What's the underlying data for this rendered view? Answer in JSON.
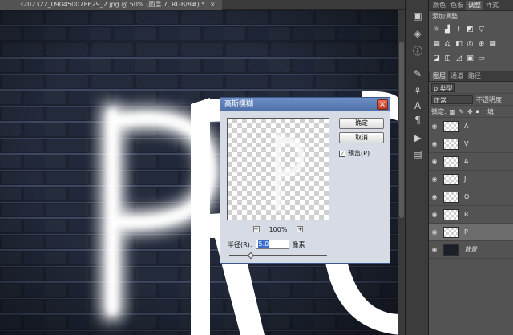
{
  "document": {
    "tab_title": "3202322_090450078629_2.jpg @ 50% (图层 7, RGB/8#) *",
    "close_glyph": "×",
    "canvas_text": "PRO"
  },
  "right_panel": {
    "top_tabs": [
      "颜色",
      "色板",
      "调整",
      "样式"
    ],
    "active_top_tab": "调整",
    "adjustments_title": "添加调整",
    "adjustment_icons": [
      [
        "brightness-icon",
        "levels-icon",
        "curves-icon",
        "exposure-icon"
      ],
      [
        "vibrance-icon",
        "hue-saturation-icon",
        "color-balance-icon",
        "black-white-icon",
        "photo-filter-icon",
        "channel-mixer-icon"
      ],
      [
        "invert-icon",
        "posterize-icon",
        "threshold-icon",
        "selective-color-icon",
        "gradient-map-icon"
      ]
    ],
    "layer_tabs": [
      "图层",
      "通道",
      "路径"
    ],
    "active_layer_tab": "图层",
    "filter_kind": "ρ 类型",
    "blend_mode": "正常",
    "opacity_label": "不透明度",
    "lock_label": "锁定:",
    "fill_label": "填"
  },
  "layers": [
    {
      "name": "A",
      "selected": false,
      "background": false
    },
    {
      "name": "V",
      "selected": false,
      "background": false
    },
    {
      "name": "A",
      "selected": false,
      "background": false
    },
    {
      "name": "J",
      "selected": false,
      "background": false
    },
    {
      "name": "O",
      "selected": false,
      "background": false
    },
    {
      "name": "R",
      "selected": false,
      "background": false
    },
    {
      "name": "P",
      "selected": true,
      "background": false
    },
    {
      "name": "背景",
      "selected": false,
      "background": true
    }
  ],
  "dialog": {
    "title": "高斯模糊",
    "close_glyph": "×",
    "ok_label": "确定",
    "cancel_label": "取消",
    "preview_label": "预览(P)",
    "preview_checked": true,
    "preview_letter": "P",
    "zoom_minus": "−",
    "zoom_plus": "+",
    "zoom_level": "100%",
    "radius_label": "半径(R):",
    "radius_value": "5.0",
    "radius_unit": "像素",
    "radius_slider_fraction": 0.22
  },
  "colors": {
    "ps_dark": "#282828",
    "panel": "#535353",
    "dialog_bg": "#d6dbe5",
    "dialog_title": "#4d6ea8",
    "glow": "#ffffff"
  }
}
